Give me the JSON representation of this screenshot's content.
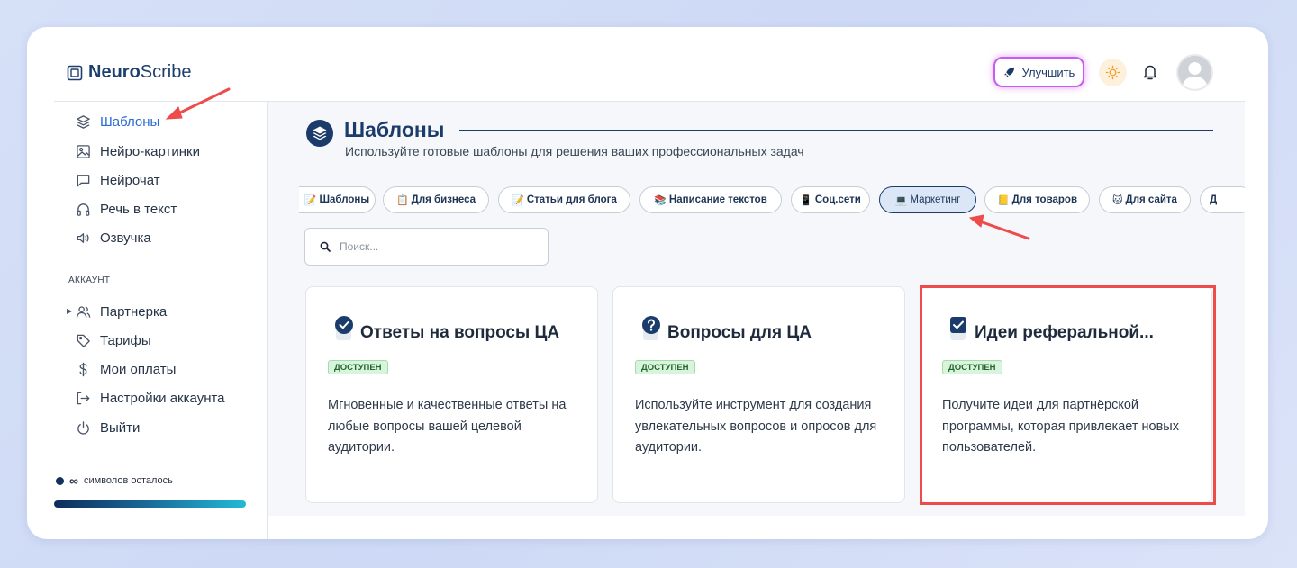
{
  "app": {
    "brand_bold": "Neuro",
    "brand_regular": "Scribe",
    "upgrade_label": "Улучшить"
  },
  "sidebar": {
    "items": [
      {
        "label": "Шаблоны",
        "icon": "layers-icon",
        "active": true
      },
      {
        "label": "Нейро-картинки",
        "icon": "image-icon"
      },
      {
        "label": "Нейрочат",
        "icon": "chat-icon"
      },
      {
        "label": "Речь в текст",
        "icon": "headphones-icon"
      },
      {
        "label": "Озвучка",
        "icon": "speaker-icon"
      }
    ],
    "account_label": "АККАУНТ",
    "account_items": [
      {
        "label": "Партнерка",
        "icon": "users-icon"
      },
      {
        "label": "Тарифы",
        "icon": "tag-icon"
      },
      {
        "label": "Мои оплаты",
        "icon": "dollar-icon"
      },
      {
        "label": "Настройки аккаунта",
        "icon": "login-icon"
      },
      {
        "label": "Выйти",
        "icon": "power-icon"
      }
    ],
    "credits_value": "∞",
    "credits_label": "символов осталось",
    "credits_fill": 1.0
  },
  "main": {
    "title": "Шаблоны",
    "subtitle": "Используйте готовые шаблоны для решения ваших профессиональных задач",
    "chips": [
      {
        "emoji": "📝",
        "label": "Шаблоны"
      },
      {
        "emoji": "📋",
        "label": "Для бизнеса"
      },
      {
        "emoji": "📝",
        "label": "Статьи для блога"
      },
      {
        "emoji": "📚",
        "label": "Написание текстов"
      },
      {
        "emoji": "📱",
        "label": "Соц.сети"
      },
      {
        "emoji": "💻",
        "label": "Маркетинг",
        "active": true
      },
      {
        "emoji": "📒",
        "label": "Для товаров"
      },
      {
        "emoji": "🐱",
        "label": "Для сайта"
      },
      {
        "emoji": "",
        "label": "Д"
      }
    ],
    "search_placeholder": "Поиск...",
    "cards": [
      {
        "title": "Ответы на вопросы ЦА",
        "badge": "ДОСТУПЕН",
        "description": "Мгновенные и качественные ответы на любые вопросы вашей целевой аудитории.",
        "icon": "check-circle-icon"
      },
      {
        "title": "Вопросы для ЦА",
        "badge": "ДОСТУПЕН",
        "description": "Используйте инструмент для создания увлекательных вопросов и опросов для аудитории.",
        "icon": "question-circle-icon"
      },
      {
        "title": "Идеи реферальной...",
        "badge": "ДОСТУПЕН",
        "description": "Получите идеи для партнёрской программы, которая привлекает новых пользователей.",
        "icon": "checkbox-icon"
      }
    ]
  },
  "colors": {
    "brand": "#1b3c6b",
    "active": "#2a6bd6",
    "annotation": "#ee4b4b",
    "badge_bg": "#d9f4dc"
  }
}
